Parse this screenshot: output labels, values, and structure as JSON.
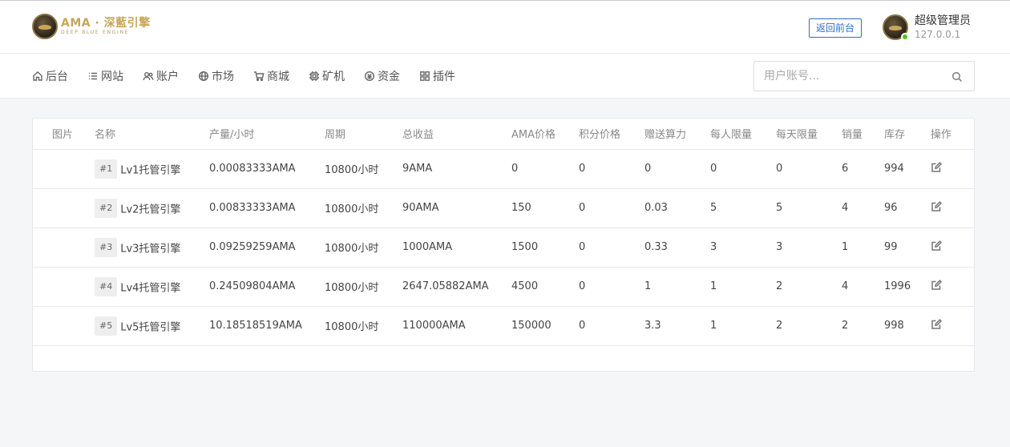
{
  "header": {
    "logo_main": "AMA · 深藍引擎",
    "logo_sub": "DEEP BLUE ENGINE",
    "back_button": "返回前台",
    "user_name": "超级管理员",
    "user_ip": "127.0.0.1"
  },
  "nav": {
    "items": [
      {
        "label": "后台",
        "icon": "home-icon"
      },
      {
        "label": "网站",
        "icon": "list-icon"
      },
      {
        "label": "账户",
        "icon": "users-icon"
      },
      {
        "label": "市场",
        "icon": "globe-icon"
      },
      {
        "label": "商城",
        "icon": "cart-icon"
      },
      {
        "label": "矿机",
        "icon": "chip-icon"
      },
      {
        "label": "资金",
        "icon": "fund-icon"
      },
      {
        "label": "插件",
        "icon": "grid-icon"
      }
    ],
    "search_placeholder": "用户账号..."
  },
  "table": {
    "headers": [
      "图片",
      "名称",
      "产量/小时",
      "周期",
      "总收益",
      "AMA价格",
      "积分价格",
      "赠送算力",
      "每人限量",
      "每天限量",
      "销量",
      "库存",
      "操作"
    ],
    "rows": [
      {
        "id": "#1",
        "name": "Lv1托管引擎",
        "output": "0.00083333AMA",
        "period": "10800小时",
        "total": "9AMA",
        "ama_price": "0",
        "point_price": "0",
        "bonus": "0",
        "per_person": "0",
        "per_day": "0",
        "sales": "6",
        "stock": "994"
      },
      {
        "id": "#2",
        "name": "Lv2托管引擎",
        "output": "0.00833333AMA",
        "period": "10800小时",
        "total": "90AMA",
        "ama_price": "150",
        "point_price": "0",
        "bonus": "0.03",
        "per_person": "5",
        "per_day": "5",
        "sales": "4",
        "stock": "96"
      },
      {
        "id": "#3",
        "name": "Lv3托管引擎",
        "output": "0.09259259AMA",
        "period": "10800小时",
        "total": "1000AMA",
        "ama_price": "1500",
        "point_price": "0",
        "bonus": "0.33",
        "per_person": "3",
        "per_day": "3",
        "sales": "1",
        "stock": "99"
      },
      {
        "id": "#4",
        "name": "Lv4托管引擎",
        "output": "0.24509804AMA",
        "period": "10800小时",
        "total": "2647.05882AMA",
        "ama_price": "4500",
        "point_price": "0",
        "bonus": "1",
        "per_person": "1",
        "per_day": "2",
        "sales": "4",
        "stock": "1996"
      },
      {
        "id": "#5",
        "name": "Lv5托管引擎",
        "output": "10.18518519AMA",
        "period": "10800小时",
        "total": "110000AMA",
        "ama_price": "150000",
        "point_price": "0",
        "bonus": "3.3",
        "per_person": "1",
        "per_day": "2",
        "sales": "2",
        "stock": "998"
      }
    ]
  },
  "colors": {
    "accent": "#2d6fc8",
    "online": "#52c41a",
    "logo_gold": "#c9a55a"
  }
}
